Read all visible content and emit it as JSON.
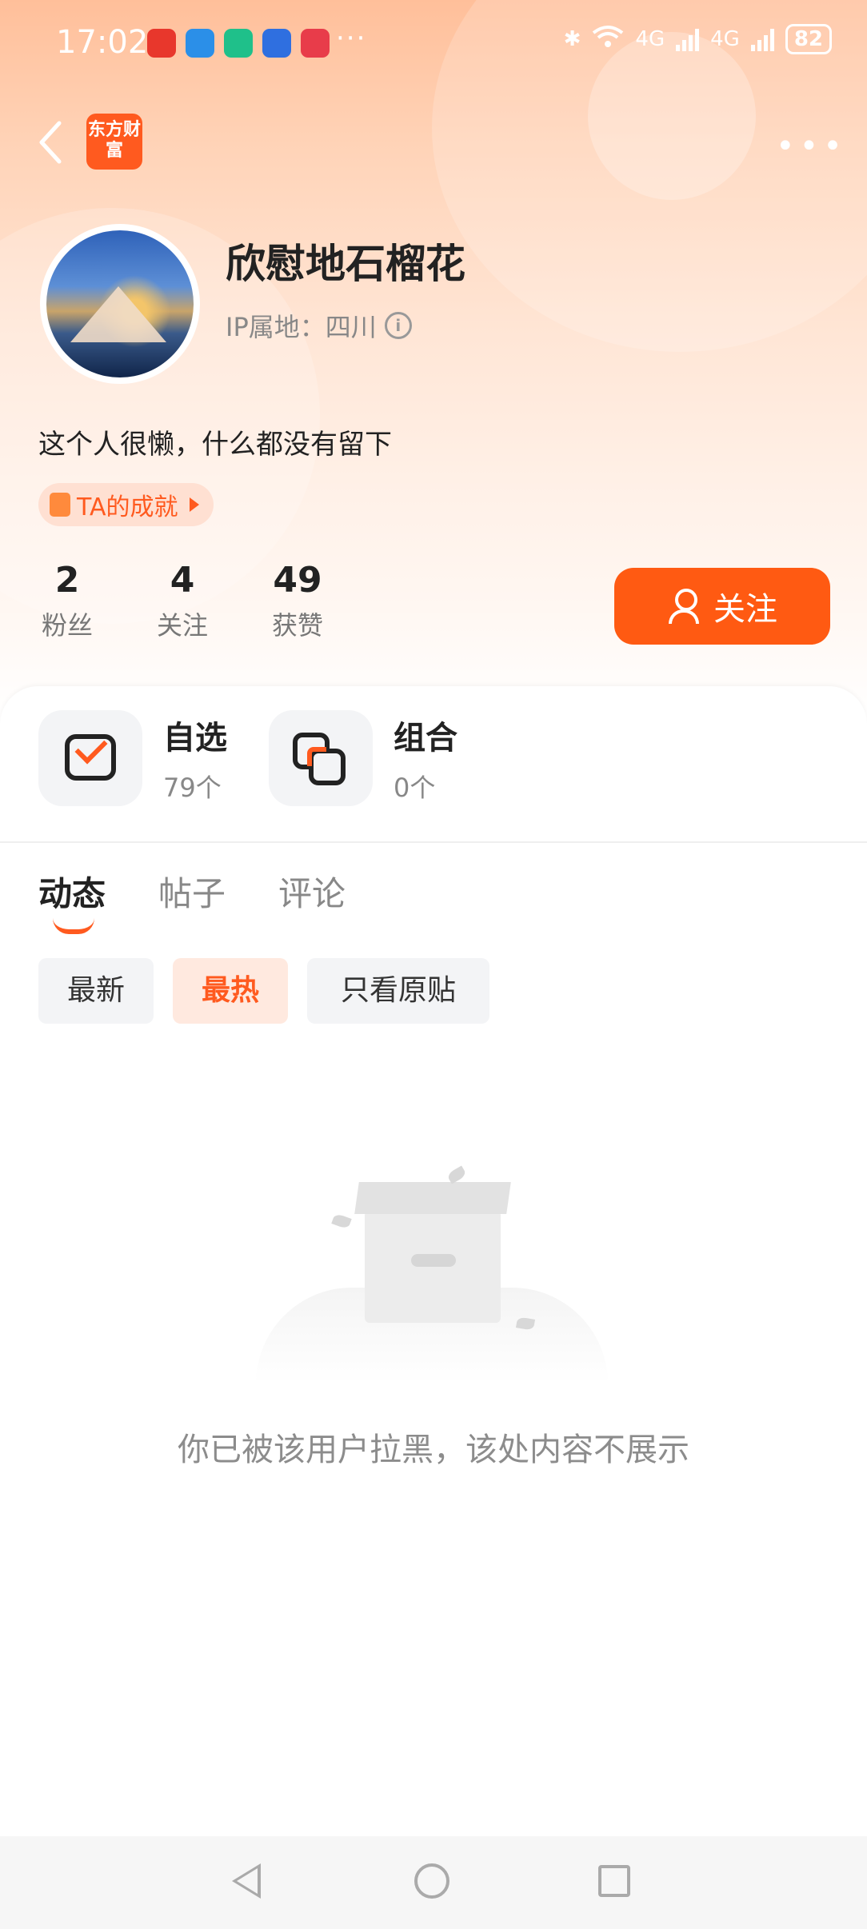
{
  "status_bar": {
    "time": "17:02",
    "battery": "82",
    "network_1": "4G",
    "network_2": "4G"
  },
  "header": {
    "logo_text": "东方财富",
    "back_icon": "chevron-left-icon",
    "more_icon": "more-horizontal-icon"
  },
  "profile": {
    "username": "欣慰地石榴花",
    "ip_label": "IP属地：四川",
    "bio": "这个人很懒，什么都没有留下",
    "achievement": "TA的成就"
  },
  "stats": [
    {
      "value": "2",
      "label": "粉丝"
    },
    {
      "value": "4",
      "label": "关注"
    },
    {
      "value": "49",
      "label": "获赞"
    }
  ],
  "follow_button": "关注",
  "tiles": [
    {
      "title": "自选",
      "count": "79个",
      "icon": "watchlist-icon"
    },
    {
      "title": "组合",
      "count": "0个",
      "icon": "portfolio-icon"
    }
  ],
  "tabs": [
    {
      "label": "动态",
      "active": true
    },
    {
      "label": "帖子",
      "active": false
    },
    {
      "label": "评论",
      "active": false
    }
  ],
  "filters": [
    {
      "label": "最新",
      "active": false
    },
    {
      "label": "最热",
      "active": true
    },
    {
      "label": "只看原贴",
      "active": false
    }
  ],
  "empty_message": "你已被该用户拉黑，该处内容不展示",
  "colors": {
    "accent": "#ff5a12",
    "hero_top": "#ffbf9a"
  }
}
